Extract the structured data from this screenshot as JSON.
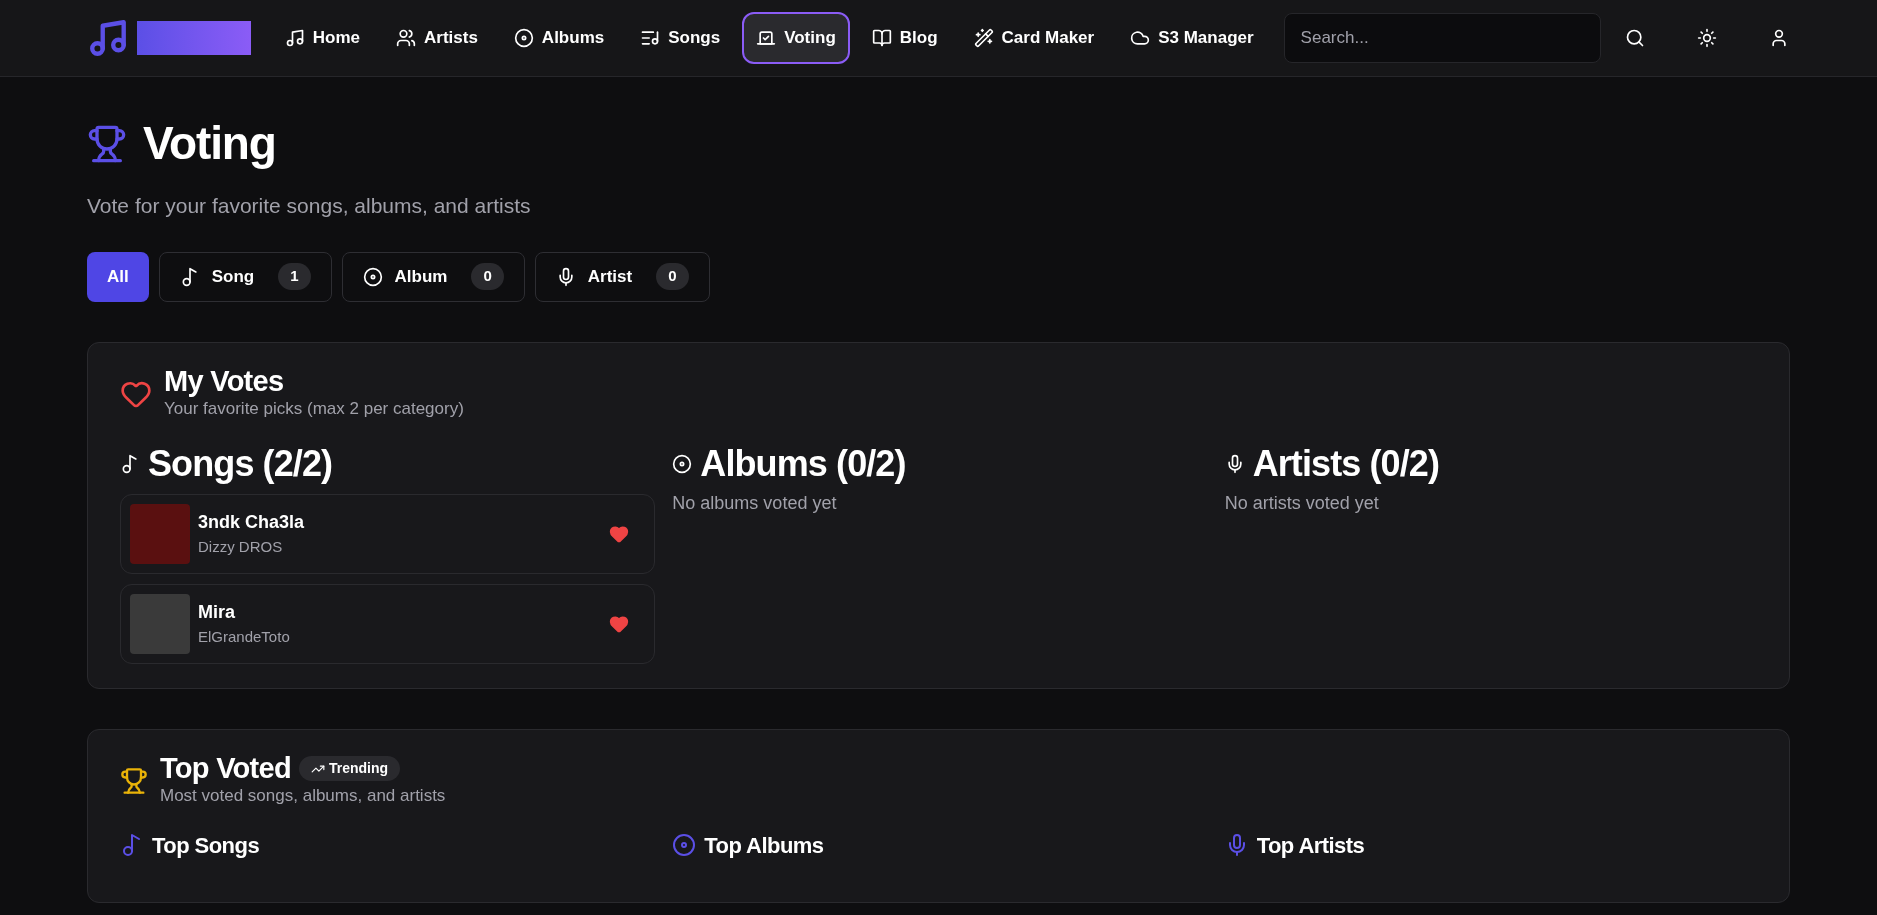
{
  "nav": {
    "items": [
      {
        "label": "Home",
        "selected": false
      },
      {
        "label": "Artists",
        "selected": false
      },
      {
        "label": "Albums",
        "selected": false
      },
      {
        "label": "Songs",
        "selected": false
      },
      {
        "label": "Voting",
        "selected": true
      },
      {
        "label": "Blog",
        "selected": false
      },
      {
        "label": "Card Maker",
        "selected": false
      },
      {
        "label": "S3 Manager",
        "selected": false
      }
    ],
    "search": {
      "placeholder": "Search..."
    }
  },
  "page": {
    "title": "Voting",
    "subtitle": "Vote for your favorite songs, albums, and artists"
  },
  "filters": [
    {
      "label": "All",
      "kind": "all",
      "selected": true
    },
    {
      "label": "Song",
      "kind": "song",
      "count": "1",
      "selected": false
    },
    {
      "label": "Album",
      "kind": "album",
      "count": "0",
      "selected": false
    },
    {
      "label": "Artist",
      "kind": "artist",
      "count": "0",
      "selected": false
    }
  ],
  "my_votes": {
    "title": "My Votes",
    "subtitle": "Your favorite picks (max 2 per category)",
    "columns": [
      {
        "kind": "song",
        "title": "Songs (2/2)",
        "items": [
          {
            "title": "3ndk Cha3la",
            "artist": "Dizzy DROS",
            "voted": true
          },
          {
            "title": "Mira",
            "artist": "ElGrandeToto",
            "voted": true
          }
        ]
      },
      {
        "kind": "album",
        "title": "Albums (0/2)",
        "empty": "No albums voted yet"
      },
      {
        "kind": "artist",
        "title": "Artists (0/2)",
        "empty": "No artists voted yet"
      }
    ]
  },
  "top_voted": {
    "title": "Top Voted",
    "badge": "Trending",
    "subtitle": "Most voted songs, albums, and artists",
    "columns": [
      {
        "kind": "song",
        "title": "Top Songs"
      },
      {
        "kind": "album",
        "title": "Top Albums"
      },
      {
        "kind": "artist",
        "title": "Top Artists"
      }
    ]
  }
}
